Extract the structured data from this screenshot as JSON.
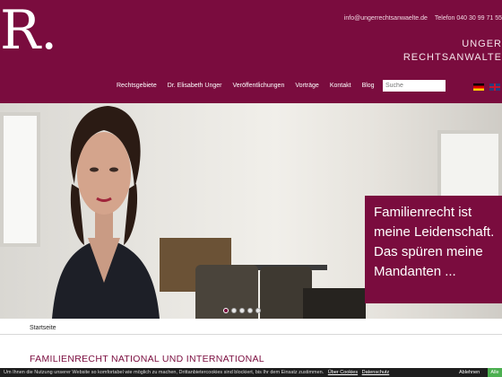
{
  "header": {
    "logo_text": "R.",
    "email": "info@ungerrechtsanwaelte.de",
    "phone": "Telefon 040 30 99 71 55",
    "firm_line1": "UNGER",
    "firm_line2": "RECHTSANWALTE"
  },
  "nav": {
    "items": [
      {
        "label": "Rechtsgebiete"
      },
      {
        "label": "Dr. Elisabeth Unger"
      },
      {
        "label": "Veröffentlichungen"
      },
      {
        "label": "Vorträge"
      },
      {
        "label": "Kontakt"
      },
      {
        "label": "Blog"
      }
    ],
    "search_placeholder": "Suche"
  },
  "hero": {
    "quote": "Familienrecht ist meine Leidenschaft. Das spüren meine Mandanten ...",
    "slides": 5,
    "active_slide": 0
  },
  "breadcrumb": "Startseite",
  "section_title": "FAMILIENRECHT NATIONAL UND INTERNATIONAL",
  "cookie": {
    "message": "Um Ihnen die Nutzung unserer Website so komfortabel wie möglich zu machen, Drittanbietercookies sind blockiert, bis Ihr dem Einsatz zustimmen.",
    "link_cookies": "Über Cookies",
    "link_privacy": "Datenschutz",
    "decline_label": "Ablehnen",
    "accept_label": "Alle"
  },
  "colors": {
    "brand": "#7a0c3e",
    "accept": "#4caf50"
  }
}
